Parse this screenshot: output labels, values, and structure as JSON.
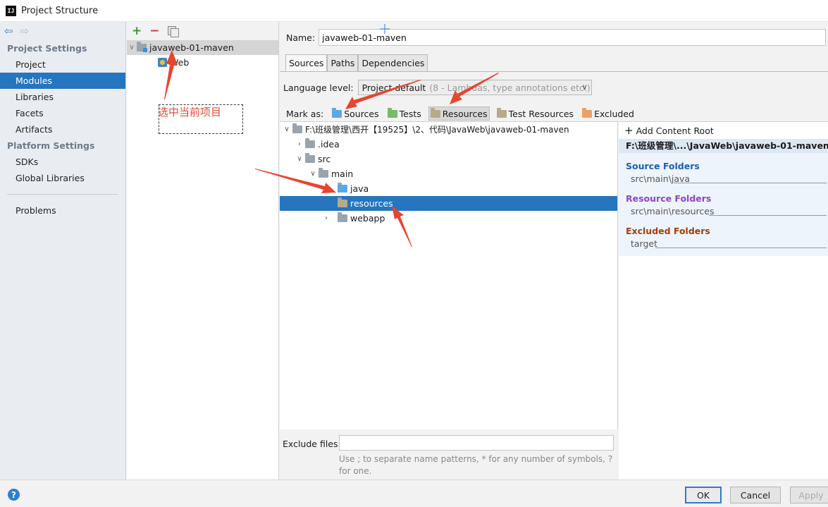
{
  "window": {
    "title": "Project Structure",
    "app_icon": "IJ"
  },
  "nav": {
    "back_icon": "arrow-left-icon",
    "forward_icon": "arrow-right-icon",
    "project_settings": {
      "title": "Project Settings",
      "items": [
        "Project",
        "Modules",
        "Libraries",
        "Facets",
        "Artifacts"
      ]
    },
    "platform_settings": {
      "title": "Platform Settings",
      "items": [
        "SDKs",
        "Global Libraries"
      ]
    },
    "problems": "Problems",
    "selected": "Modules"
  },
  "modules": {
    "toolbar": {
      "add": "+",
      "remove": "−"
    },
    "items": [
      {
        "label": "javaweb-01-maven",
        "expanded": true,
        "selected": true
      },
      {
        "label": "Web"
      }
    ],
    "annotation": "选中当前项目"
  },
  "main": {
    "name_label": "Name:",
    "name_value": "javaweb-01-maven",
    "tabs": [
      "Sources",
      "Paths",
      "Dependencies"
    ],
    "active_tab": "Sources",
    "language_label": "Language level:",
    "language_value": "Project default",
    "language_hint": "(8 - Lambdas, type annotations etc.)",
    "mark_label": "Mark as:",
    "mark_buttons": [
      {
        "label": "Sources",
        "color": "#5aa9e6"
      },
      {
        "label": "Tests",
        "color": "#7cb86a"
      },
      {
        "label": "Resources",
        "color": "#b5aa8a",
        "pressed": true
      },
      {
        "label": "Test Resources",
        "color": "#b5aa8a"
      },
      {
        "label": "Excluded",
        "color": "#f0a060"
      }
    ],
    "tree": [
      {
        "label": "F:\\班级管理\\西开【19525】\\2、代码\\JavaWeb\\javaweb-01-maven",
        "depth": 0,
        "chevron": "down",
        "color": "#9aa4ad"
      },
      {
        "label": ".idea",
        "depth": 1,
        "chevron": "right",
        "color": "#9aa4ad"
      },
      {
        "label": "src",
        "depth": 1,
        "chevron": "down",
        "color": "#9aa4ad"
      },
      {
        "label": "main",
        "depth": 2,
        "chevron": "down",
        "color": "#9aa4ad"
      },
      {
        "label": "java",
        "depth": 3,
        "chevron": "",
        "color": "#5aa9e6"
      },
      {
        "label": "resources",
        "depth": 3,
        "chevron": "",
        "color": "#b5aa8a",
        "selected": true
      },
      {
        "label": "webapp",
        "depth": 3,
        "chevron": "right",
        "color": "#9aa4ad"
      }
    ],
    "exclude_label": "Exclude files:",
    "exclude_hint": "Use ; to separate name patterns, * for any number of symbols, ? for one."
  },
  "content_roots": {
    "add_label": "Add Content Root",
    "root_path": "F:\\班级管理\\...\\JavaWeb\\javaweb-01-maven",
    "source_title": "Source Folders",
    "source_color": "#1a5fb4",
    "source_items": [
      "src\\main\\java"
    ],
    "resource_title": "Resource Folders",
    "resource_color": "#8e44c8",
    "resource_items": [
      "src\\main\\resources"
    ],
    "excluded_title": "Excluded Folders",
    "excluded_color": "#a0400c",
    "excluded_items": [
      "target"
    ]
  },
  "buttons": {
    "help": "?",
    "ok": "OK",
    "cancel": "Cancel",
    "apply": "Apply"
  },
  "colors": {
    "selection": "#2675bf",
    "annotation": "#e8442f"
  }
}
